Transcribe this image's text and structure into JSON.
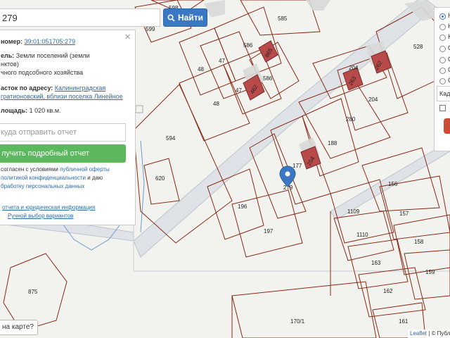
{
  "search": {
    "value": "279",
    "button_label": "Найти"
  },
  "panel": {
    "cad_number_label": "номер:",
    "cad_number": "39:01:051705:279",
    "purpose_label": "ель:",
    "purpose_text_1": "Земли поселений (земли",
    "purpose_text_2": "нктов)",
    "purpose_text_3": "чного подсобного хозяйства",
    "address_label": "асток по адресу:",
    "address_link_1": "Калининградская",
    "address_link_2": "гратионовский, вблизи поселка Линейное",
    "area_label": "лощадь:",
    "area_value": "1 020 кв.м.",
    "email_placeholder": "куда отправить отчет",
    "report_button": "лучить подробный отчет",
    "agree_1": "согласен с условиями",
    "agree_link_1": "публичной оферты",
    "agree_2": "политикой конфиденциальности",
    "agree_3": "и даю",
    "agree_4": "бработку персональных данных",
    "link_report_info": "отчета и юридическая информация",
    "link_manual": "Ручной выбор вариантов"
  },
  "layers": {
    "items": [
      "Н",
      "Н",
      "К",
      "О",
      "С",
      "С",
      "С"
    ],
    "cad_field": "Када",
    "checkbox_checked": false
  },
  "map": {
    "parcel_labels": [
      "599",
      "598",
      "585",
      "586",
      "865",
      "528",
      "48",
      "47",
      "586",
      "462",
      "47",
      "48",
      "204",
      "262",
      "263",
      "204",
      "280",
      "594",
      "188",
      "177",
      "254",
      "279",
      "620",
      "156",
      "1109",
      "157",
      "196",
      "197",
      "1110",
      "158",
      "163",
      "159",
      "162",
      "875",
      "170/1",
      "161"
    ]
  },
  "question_button": "на карте?",
  "attribution": {
    "leaflet": "Leaflet",
    "rest": "| © Публ"
  },
  "colors": {
    "parcel": "#8a2a14",
    "house": "#b94a4a",
    "search_button": "#3b78c3",
    "report_button": "#5cb85c",
    "marker": "#3b78c3"
  }
}
